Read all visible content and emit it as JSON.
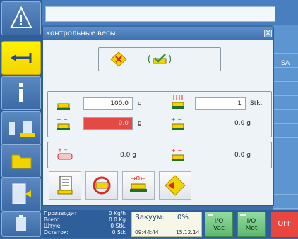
{
  "dialog": {
    "title": "контрольные весы",
    "close_label": "X"
  },
  "limits": {
    "upper_value": "100.0",
    "upper_unit": "g",
    "count_value": "1",
    "count_unit": "Stk.",
    "lower_value": "0.0",
    "lower_unit": "g",
    "lower_tol_value": "0.0",
    "lower_tol_unit": "g"
  },
  "tare": {
    "value": "0.0",
    "unit": "g",
    "value2": "0.0",
    "unit2": "g"
  },
  "right_panel": {
    "sa_label": "SA"
  },
  "status": {
    "row1_label": "Производит",
    "row1_value": "0 Kg/h",
    "row2_label": "Всего:",
    "row2_value": "0.0 Kg",
    "row3_label": "Штук:",
    "row3_value": "0 Stk.",
    "row4_label": "Остаток:",
    "row4_value": "0 Stk",
    "vacuum_label": "Вакуум:",
    "vacuum_value": "0%",
    "time": "09:44:44",
    "date": "15.12.14",
    "io_vac_top": "I/O",
    "io_vac_bottom": "Vac",
    "io_mot_top": "I/O",
    "io_mot_bottom": "Mot",
    "off_label": "OFF"
  },
  "icons": [
    "warning-icon",
    "weighing-wand-icon",
    "info-icon",
    "scale-check-icon",
    "folder-icon",
    "exit-icon",
    "tool-icon"
  ],
  "colors": {
    "accent_yellow": "#f2d400",
    "error_field": "#e34a44",
    "io_green": "#5fb86f",
    "off_red": "#e8463e",
    "panel_blue": "#2f5f9b"
  }
}
